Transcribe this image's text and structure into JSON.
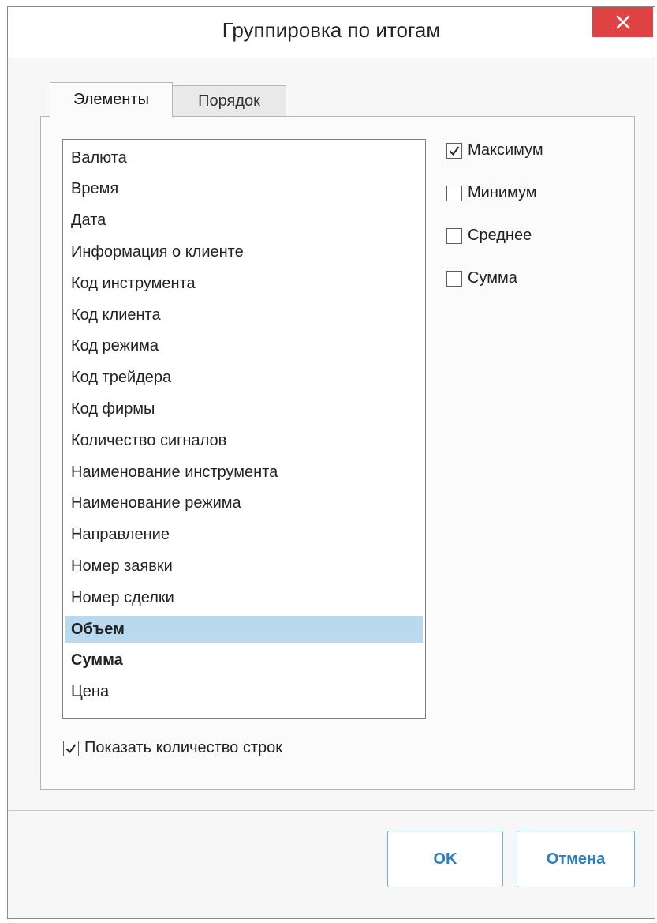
{
  "dialog": {
    "title": "Группировка по итогам",
    "close_icon": "close-icon"
  },
  "tabs": [
    {
      "label": "Элементы",
      "active": true
    },
    {
      "label": "Порядок",
      "active": false
    }
  ],
  "fields_list": {
    "items": [
      {
        "label": "Валюта",
        "bold": false,
        "selected": false
      },
      {
        "label": "Время",
        "bold": false,
        "selected": false
      },
      {
        "label": "Дата",
        "bold": false,
        "selected": false
      },
      {
        "label": "Информация о клиенте",
        "bold": false,
        "selected": false
      },
      {
        "label": "Код инструмента",
        "bold": false,
        "selected": false
      },
      {
        "label": "Код клиента",
        "bold": false,
        "selected": false
      },
      {
        "label": "Код режима",
        "bold": false,
        "selected": false
      },
      {
        "label": "Код трейдера",
        "bold": false,
        "selected": false
      },
      {
        "label": "Код фирмы",
        "bold": false,
        "selected": false
      },
      {
        "label": "Количество сигналов",
        "bold": false,
        "selected": false
      },
      {
        "label": "Наименование инструмента",
        "bold": false,
        "selected": false
      },
      {
        "label": "Наименование режима",
        "bold": false,
        "selected": false
      },
      {
        "label": "Направление",
        "bold": false,
        "selected": false
      },
      {
        "label": "Номер заявки",
        "bold": false,
        "selected": false
      },
      {
        "label": "Номер сделки",
        "bold": false,
        "selected": false
      },
      {
        "label": "Объем",
        "bold": true,
        "selected": true
      },
      {
        "label": "Сумма",
        "bold": true,
        "selected": false
      },
      {
        "label": "Цена",
        "bold": false,
        "selected": false
      }
    ]
  },
  "aggregates": [
    {
      "label": "Максимум",
      "checked": true
    },
    {
      "label": "Минимум",
      "checked": false
    },
    {
      "label": "Среднее",
      "checked": false
    },
    {
      "label": "Сумма",
      "checked": false
    }
  ],
  "show_row_count": {
    "label": "Показать количество строк",
    "checked": true
  },
  "buttons": {
    "ok": "OK",
    "cancel": "Отмена"
  },
  "colors": {
    "accent": "#2b7ec0",
    "selection": "#b9d9ef",
    "close": "#e04343"
  }
}
